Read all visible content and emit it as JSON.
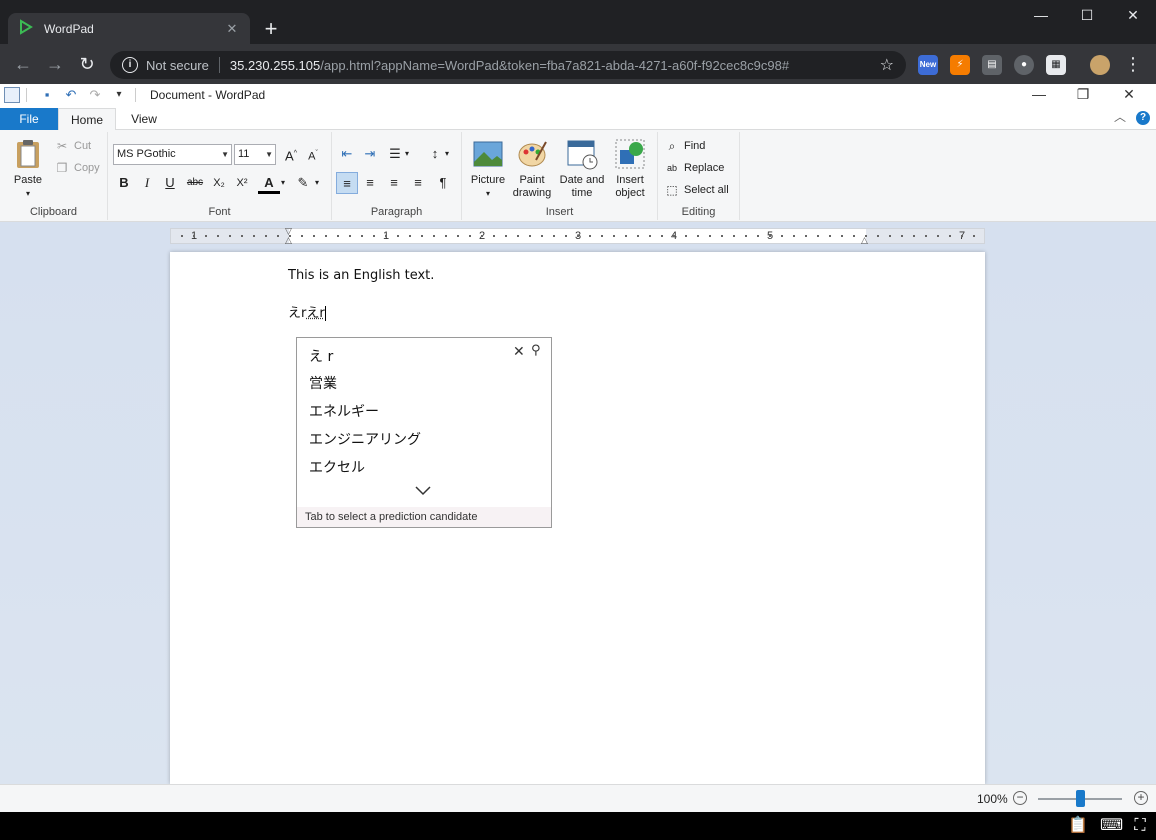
{
  "browser": {
    "tab_title": "WordPad",
    "tab_close": "✕",
    "new_tab": "+",
    "security_label": "Not secure",
    "url_host": "35.230.255.105",
    "url_path": "/app.html?appName=WordPad&token=fba7a821-abda-4271-a60f-f92cec8c9c98#",
    "ext_badge": "New",
    "colors": {
      "frame": "#202124",
      "toolbar": "#35363a",
      "accent": "#1979ca"
    }
  },
  "wordpad": {
    "title": "Document - WordPad",
    "tabs": {
      "file": "File",
      "home": "Home",
      "view": "View"
    },
    "clipboard": {
      "paste": "Paste",
      "cut": "Cut",
      "copy": "Copy",
      "label": "Clipboard"
    },
    "font": {
      "family": "MS PGothic",
      "size": "11",
      "label": "Font"
    },
    "paragraph": {
      "label": "Paragraph"
    },
    "insert": {
      "picture": "Picture",
      "paint_1": "Paint",
      "paint_2": "drawing",
      "datetime_1": "Date and",
      "datetime_2": "time",
      "object_1": "Insert",
      "object_2": "object",
      "label": "Insert"
    },
    "editing": {
      "find": "Find",
      "replace": "Replace",
      "select_all": "Select all",
      "label": "Editing"
    },
    "ruler": [
      "1",
      "1",
      "2",
      "3",
      "4",
      "5",
      "7"
    ],
    "document": {
      "line1": "This is an English text.",
      "line2_committed": "えr",
      "line2_composing": "えr"
    },
    "status": {
      "zoom": "100%"
    }
  },
  "ime": {
    "input": "え r",
    "candidates": [
      "営業",
      "エネルギー",
      "エンジニアリング",
      "エクセル"
    ],
    "footer": "Tab to select a prediction candidate"
  }
}
